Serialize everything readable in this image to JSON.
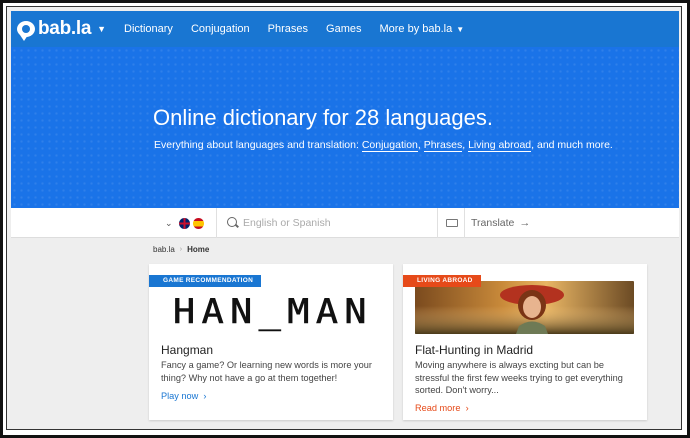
{
  "nav": {
    "logo": "bab.la",
    "items": [
      "Dictionary",
      "Conjugation",
      "Phrases",
      "Games",
      "More by bab.la"
    ]
  },
  "hero": {
    "title": "Online dictionary for 28 languages.",
    "subtitle_prefix": "Everything about languages and translation:",
    "links": [
      "Conjugation",
      "Phrases",
      "Living abroad"
    ],
    "subtitle_suffix": ", and much more."
  },
  "search": {
    "placeholder": "English or Spanish",
    "translate_label": "Translate",
    "flags": [
      "uk-flag",
      "es-flag"
    ]
  },
  "breadcrumb": {
    "root": "bab.la",
    "current": "Home"
  },
  "cards": [
    {
      "badge": "GAME RECOMMENDATION",
      "art_text": "HAN_MAN",
      "title": "Hangman",
      "text": "Fancy a game? Or learning new words is more your thing? Why not have a go at them together!",
      "link": "Play now"
    },
    {
      "badge": "LIVING ABROAD",
      "title": "Flat-Hunting in Madrid",
      "text": "Moving anywhere is always excting but can be stressful the first few weeks trying to get everything sorted. Don't worry...",
      "link": "Read more"
    }
  ],
  "colors": {
    "brand_blue": "#1976d2",
    "accent_orange": "#e64a19"
  }
}
